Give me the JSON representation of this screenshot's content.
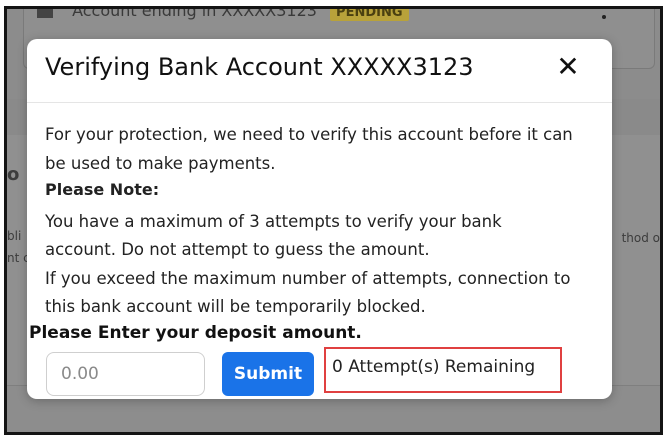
{
  "background": {
    "account_row": "Account ending in XXXXX3123",
    "status_badge": "PENDING",
    "left_fragment": "o",
    "left_fragment_2": "bli",
    "left_fragment_3": "nt c",
    "right_fragment": "thod o"
  },
  "modal": {
    "title": "Verifying Bank Account XXXXX3123",
    "close_label": "✕",
    "intro_line1": "For your protection, we need to verify this account before it can",
    "intro_line2": "be used to make payments.",
    "note_label": "Please Note:",
    "note_line1": "You have a maximum of 3 attempts to verify your bank",
    "note_line2": "account. Do not attempt to guess the amount.",
    "note_line3": "If you exceed the maximum number of attempts, connection to",
    "note_line4": "this bank account will be temporarily blocked.",
    "deposit_label": "Please Enter your deposit amount.",
    "amount_placeholder": "0.00",
    "amount_value": "",
    "submit_label": "Submit",
    "attempts_remaining": "0 Attempt(s) Remaining"
  },
  "colors": {
    "submit_blue": "#1a73e8",
    "highlight_red": "#e04040",
    "overlay_gray": "#8c8c8c"
  }
}
